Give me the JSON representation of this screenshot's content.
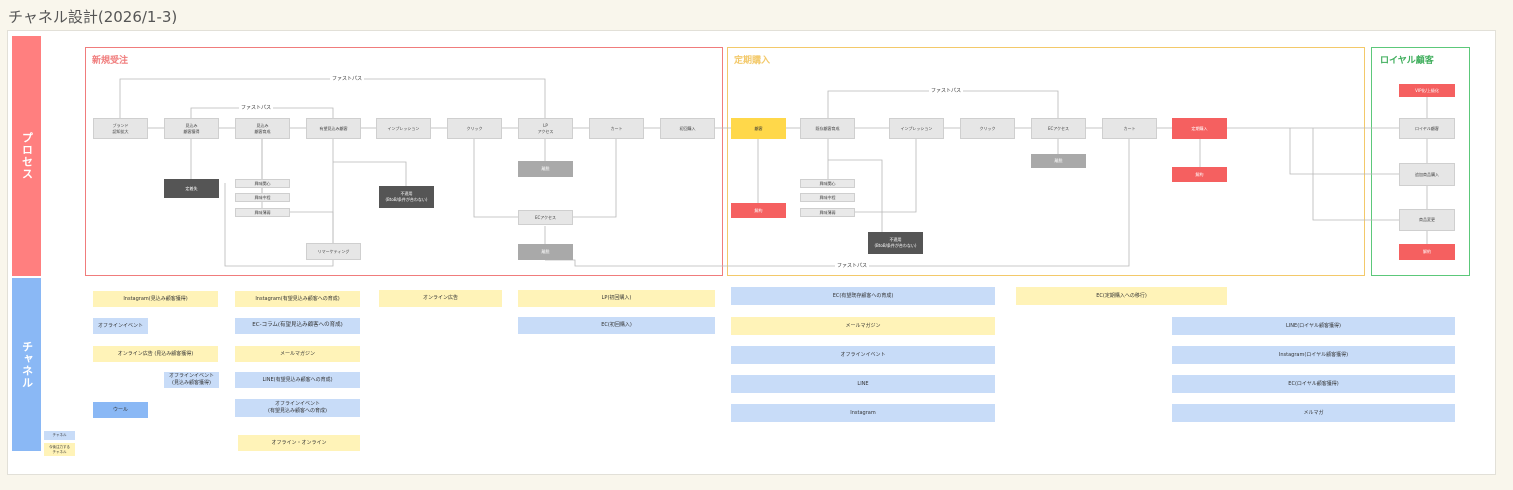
{
  "title": "チャネル設計(2026/1-3)",
  "lanes": {
    "process": "プロセス",
    "channel": "チャネル"
  },
  "colors": {
    "process_lane": "#ff7f7f",
    "channel_lane": "#8ab8f5",
    "new": "#f07c7c",
    "regular": "#f3c96a",
    "loyal": "#5cc87a"
  },
  "phases": {
    "new": "新規受注",
    "regular": "定期購入",
    "loyal": "ロイヤル顧客"
  },
  "fastpass": "ファストパス",
  "nodes": {
    "brand": "ブランド\n認知拡大",
    "prospect": "見込み\n顧客獲得",
    "prospect_nurture": "見込み\n顧客育成",
    "promising": "有望見込み顧客",
    "impression": "インプレッション",
    "click": "クリック",
    "lp_access": "LP\nアクセス",
    "cart": "カート",
    "first_purchase": "初回購入",
    "withdraw1": "離脱",
    "ec_access": "ECアクセス",
    "withdraw2": "離脱",
    "unsub": "定着失",
    "interest_high": "興味関心",
    "interest_mid": "興味中程",
    "interest_low": "興味薄弱",
    "loss1": "不適用\n(BtoB/条件が合わない)",
    "remarketing": "リマーケティング",
    "customer": "顧客",
    "regular_nurture": "既存顧客育成",
    "impression2": "インプレッション",
    "click2": "クリック",
    "ec_access2": "ECアクセス",
    "withdraw3": "離脱",
    "cart2": "カート",
    "regular_purchase": "定期購入",
    "cancel1": "解約",
    "interest_high2": "興味関心",
    "interest_mid2": "興味中程",
    "interest_low2": "興味薄弱",
    "loss2": "不適用\n(BtoB/条件が合わない)",
    "cancel2": "解約",
    "cancel3": "解約",
    "loyal_top": "VIP化/上級化",
    "loyal_customer": "ロイヤル顧客",
    "repeat": "追加商品購入",
    "product_change": "商品変更",
    "cancel4": "解約"
  },
  "channels": {
    "c1": "Instagram(見込み顧客獲得)",
    "c2": "オフラインイベント",
    "c3": "オンライン広告 (見込み顧客獲得)",
    "c4": "オフラインイベント\n(見込み顧客獲得)",
    "c5": "ウール",
    "c6": "Instagram(有望見込み顧客への育成)",
    "c7": "EC-コラム(有望見込み顧客への育成)",
    "c8": "メールマガジン",
    "c9": "LINE(有望見込み顧客への育成)",
    "c10": "オフラインイベント\n(有望見込み顧客への育成)",
    "c11": "オフライン・オンライン",
    "c12": "オンライン広告",
    "c13": "LP(初回購入)",
    "c14": "EC(初回購入)",
    "c15": "EC(有望既存顧客への育成)",
    "c16": "メールマガジン",
    "c17": "オフラインイベント",
    "c18": "LINE",
    "c19": "Instagram",
    "c20": "EC(定期購入への移行)",
    "c21": "LINE(ロイヤル顧客獲得)",
    "c22": "Instagram(ロイヤル顧客獲得)",
    "c23": "EC(ロイヤル顧客獲得)",
    "c24": "メルマガ"
  },
  "legend": {
    "a": "チャネル",
    "b": "今後注力する\nチャネル"
  }
}
